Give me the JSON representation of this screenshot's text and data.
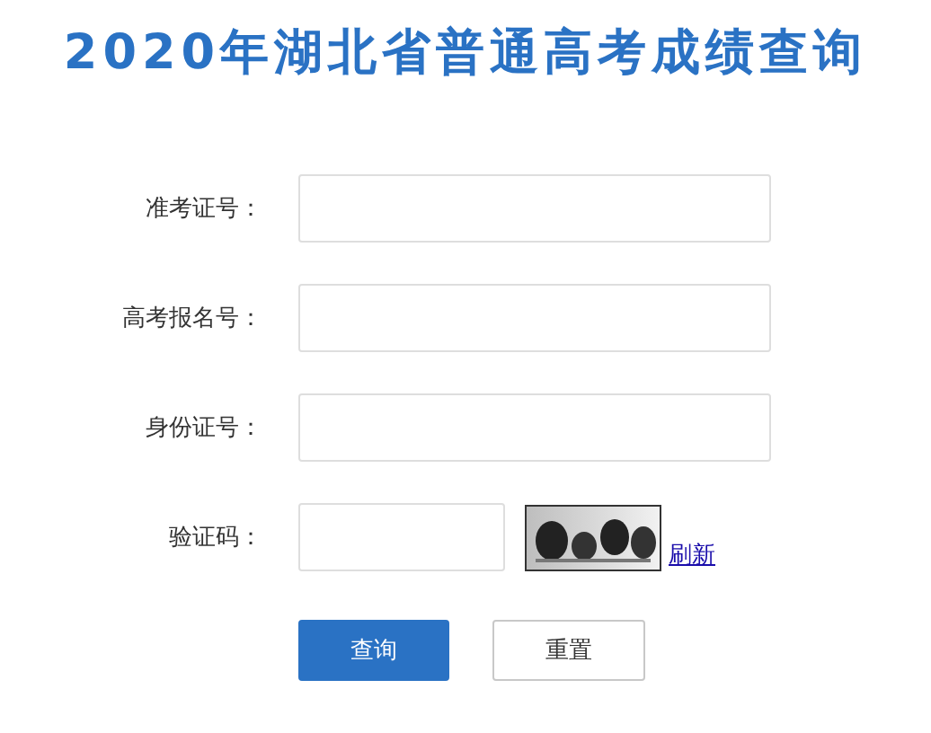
{
  "title": "2020年湖北省普通高考成绩查询",
  "fields": [
    {
      "label": "准考证号：",
      "kind": "text"
    },
    {
      "label": "高考报名号：",
      "kind": "text"
    },
    {
      "label": "身份证号：",
      "kind": "text"
    },
    {
      "label": "验证码：",
      "kind": "captcha",
      "refresh_link": "刷新"
    }
  ],
  "buttons": [
    {
      "label": "查询",
      "kind": "primary"
    },
    {
      "label": "重置",
      "kind": "secondary"
    }
  ]
}
